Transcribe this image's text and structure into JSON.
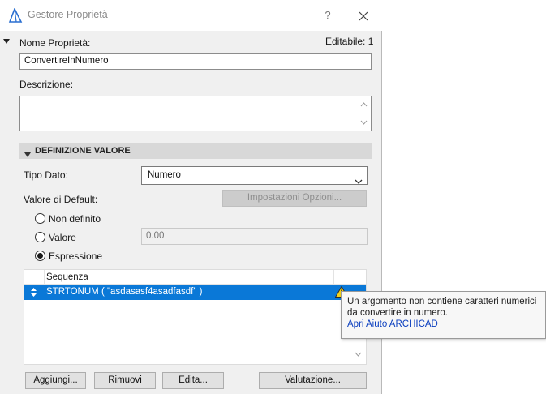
{
  "window": {
    "title": "Gestore Proprietà",
    "help_label": "?",
    "close_label": "✕"
  },
  "property": {
    "name_label": "Nome Proprietà:",
    "editable_label": "Editabile: 1",
    "name_value": "ConvertireInNumero",
    "description_label": "Descrizione:",
    "description_value": ""
  },
  "value_definition": {
    "section_title": "DEFINIZIONE VALORE",
    "data_type_label": "Tipo Dato:",
    "data_type_value": "Numero",
    "default_label": "Valore di Default:",
    "options_button": "Impostazioni Opzioni...",
    "radio_undefined": "Non definito",
    "radio_value": "Valore",
    "value_field": "0.00",
    "radio_expression": "Espressione",
    "selected_radio": "Espressione"
  },
  "sequence": {
    "column_header": "Sequenza",
    "rows": [
      {
        "text": "STRTONUM ( \"asdasasf4asadfasdf\" )",
        "selected": true,
        "warning": true
      }
    ]
  },
  "buttons": {
    "add": "Aggiungi...",
    "remove": "Rimuovi",
    "edit": "Edita...",
    "evaluate": "Valutazione..."
  },
  "tooltip": {
    "line1": "Un argomento non contiene caratteri numerici",
    "line2": "da convertire in numero.",
    "link": "Apri Aiuto ARCHICAD"
  },
  "colors": {
    "selection": "#0a78d7",
    "warning": "#f2d21b",
    "link": "#0a3ebf"
  }
}
